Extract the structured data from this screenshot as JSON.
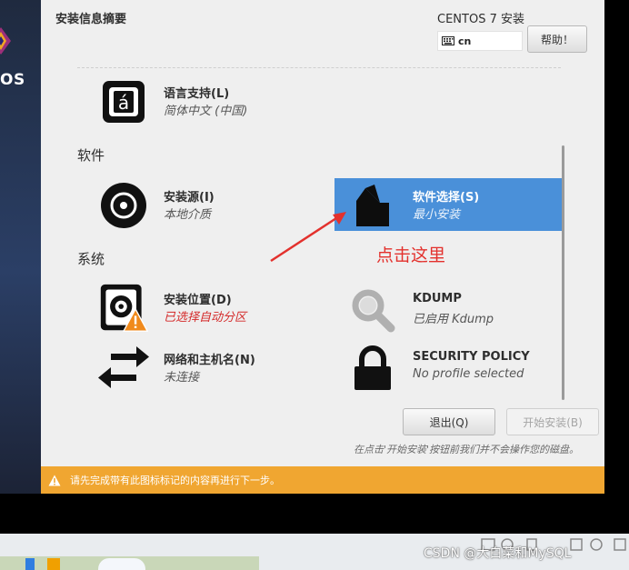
{
  "window": {
    "title": "安装信息摘要",
    "product": "CENTOS 7 安装",
    "keyboard": "cn",
    "help_label": "帮助！",
    "logo_text": "OS"
  },
  "categories": {
    "software": "软件",
    "system": "系统"
  },
  "spokes": {
    "language": {
      "title": "语言支持(L)",
      "status": "简体中文 (中国)",
      "icon": "language-icon"
    },
    "source": {
      "title": "安装源(I)",
      "status": "本地介质",
      "icon": "disc-icon"
    },
    "software_selection": {
      "title": "软件选择(S)",
      "status": "最小安装",
      "icon": "package-icon"
    },
    "destination": {
      "title": "安装位置(D)",
      "status": "已选择自动分区",
      "icon": "harddisk-warning-icon"
    },
    "kdump": {
      "title": "KDUMP",
      "status": "已启用 Kdump",
      "icon": "magnifier-icon"
    },
    "network": {
      "title": "网络和主机名(N)",
      "status": "未连接",
      "icon": "network-arrows-icon"
    },
    "security": {
      "title": "SECURITY POLICY",
      "status": "No profile selected",
      "icon": "padlock-icon"
    }
  },
  "buttons": {
    "quit": "退出(Q)",
    "begin": "开始安装(B)"
  },
  "note": "在点击'开始安装'按钮前我们并不会操作您的磁盘。",
  "warning": "请先完成带有此图标标记的内容再进行下一步。",
  "annotation": "点击这里",
  "watermark": "CSDN @大白菜和MySQL",
  "colors": {
    "accent": "#4a90d9",
    "warning_bar": "#f0a631",
    "annotation": "#e3312d"
  }
}
